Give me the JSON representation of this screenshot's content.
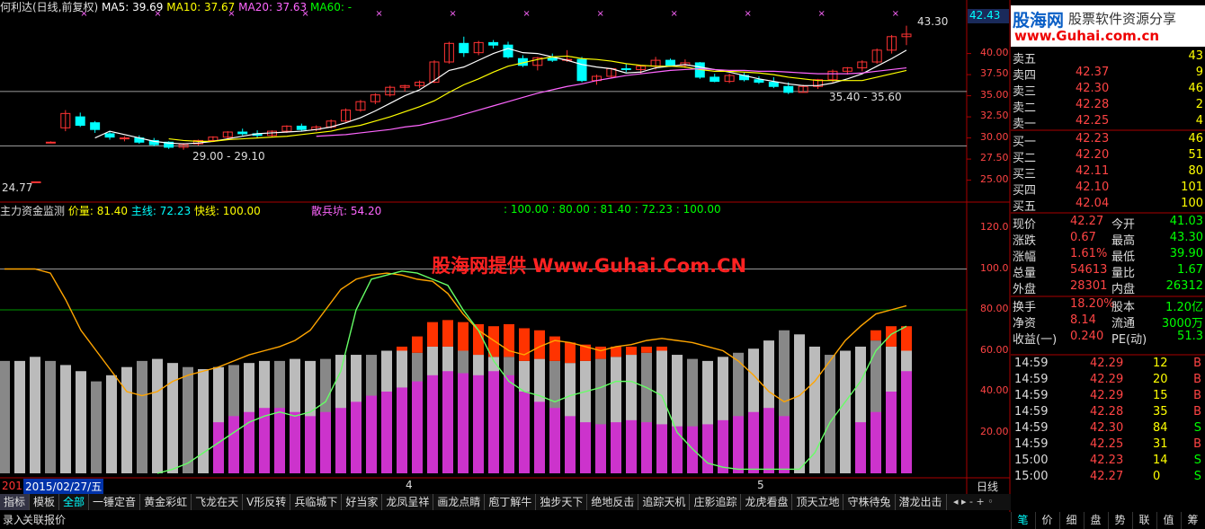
{
  "main_header": {
    "name": "何利达(日线,前复权)",
    "ma5": "MA5: 39.69",
    "ma10": "MA10: 37.67",
    "ma20": "MA20: 37.63",
    "ma60": "MA60: -"
  },
  "sub_header": {
    "name": "主力资金监测",
    "jialiang": "价量: 81.40",
    "zhuxian": "主线: 72.23",
    "kuaixian": "快线: 100.00",
    "sanbing": "散兵坑: 54.20",
    "values": ": 100.00 : 80.00 : 81.40 : 72.23 : 100.00"
  },
  "annotations": {
    "high_label": "43.30",
    "low_label": "24.77",
    "range1": "29.00 - 29.10",
    "range2": "35.40 - 35.60",
    "cur_price_tag": "42.43"
  },
  "price_axis": [
    "40.00",
    "37.50",
    "35.00",
    "32.50",
    "30.00",
    "27.50",
    "25.00"
  ],
  "ind_axis": [
    "120.0",
    "100.0",
    "80.00",
    "60.00",
    "40.00",
    "20.00"
  ],
  "time_axis": {
    "date_label": "2015/02/27/五",
    "left_num": "201",
    "m4": "4",
    "m5": "5",
    "period": "日线"
  },
  "watermark": "股海网提供 Www.Guhai.Com.CN",
  "logo": {
    "cn": "股海网",
    "slogan": "股票软件资源分享",
    "url": "www.Guhai.com.cn"
  },
  "order_book": [
    {
      "label": "卖五",
      "price": "",
      "vol": "43"
    },
    {
      "label": "卖四",
      "price": "42.37",
      "vol": "9"
    },
    {
      "label": "卖三",
      "price": "42.30",
      "vol": "46"
    },
    {
      "label": "卖二",
      "price": "42.28",
      "vol": "2"
    },
    {
      "label": "卖一",
      "price": "42.25",
      "vol": "4"
    },
    {
      "label": "买一",
      "price": "42.23",
      "vol": "46"
    },
    {
      "label": "买二",
      "price": "42.20",
      "vol": "51"
    },
    {
      "label": "买三",
      "price": "42.11",
      "vol": "80"
    },
    {
      "label": "买四",
      "price": "42.10",
      "vol": "101"
    },
    {
      "label": "买五",
      "price": "42.04",
      "vol": "100"
    }
  ],
  "stats": [
    {
      "l1": "现价",
      "v1": "42.27",
      "l2": "今开",
      "v2": "41.03"
    },
    {
      "l1": "涨跌",
      "v1": "0.67",
      "l2": "最高",
      "v2": "43.30"
    },
    {
      "l1": "涨幅",
      "v1": "1.61%",
      "l2": "最低",
      "v2": "39.90"
    },
    {
      "l1": "总量",
      "v1": "54613",
      "l2": "量比",
      "v2": "1.67"
    },
    {
      "l1": "外盘",
      "v1": "28301",
      "l2": "内盘",
      "v2": "26312"
    },
    {
      "l1": "换手",
      "v1": "18.20%",
      "l2": "股本",
      "v2": "1.20亿"
    },
    {
      "l1": "净资",
      "v1": "8.14",
      "l2": "流通",
      "v2": "3000万"
    },
    {
      "l1": "收益(一)",
      "v1": "0.240",
      "l2": "PE(动)",
      "v2": "51.3"
    }
  ],
  "ticks": [
    {
      "t": "14:59",
      "p": "42.29",
      "v": "12",
      "s": "B"
    },
    {
      "t": "14:59",
      "p": "42.29",
      "v": "20",
      "s": "B"
    },
    {
      "t": "14:59",
      "p": "42.29",
      "v": "15",
      "s": "B"
    },
    {
      "t": "14:59",
      "p": "42.28",
      "v": "35",
      "s": "B"
    },
    {
      "t": "14:59",
      "p": "42.30",
      "v": "84",
      "s": "S"
    },
    {
      "t": "14:59",
      "p": "42.25",
      "v": "31",
      "s": "B"
    },
    {
      "t": "15:00",
      "p": "42.23",
      "v": "14",
      "s": "S"
    },
    {
      "t": "15:00",
      "p": "42.27",
      "v": "0",
      "s": "S"
    }
  ],
  "tabs": [
    "指标",
    "模板",
    "全部",
    "一锤定音",
    "黄金彩虹",
    "飞龙在天",
    "V形反转",
    "兵临城下",
    "好当家",
    "龙凤呈祥",
    "画龙点睛",
    "庖丁解牛",
    "独步天下",
    "绝地反击",
    "追踪天机",
    "庄影追踪",
    "龙虎看盘",
    "顶天立地",
    "守株待兔",
    "潜龙出击"
  ],
  "bottom_tabs": [
    "录入",
    "关联报价"
  ],
  "bottom_right_tabs": [
    "笔",
    "价",
    "细",
    "盘",
    "势",
    "联",
    "值",
    "筹"
  ],
  "colors": {
    "up": "#ff3333",
    "down": "#00ffff",
    "ma5": "#ffffff",
    "ma10": "#ffff00",
    "ma20": "#ff66ff",
    "orange": "#ffa500",
    "green": "#66ff66"
  },
  "chart_data": [
    {
      "type": "candlestick",
      "title": "何利达(日线,前复权)",
      "ylim": [
        24,
        44
      ],
      "ohlc": [
        [
          24.8,
          24.8,
          24.8,
          24.8
        ],
        [
          29.5,
          29.6,
          29.4,
          29.5
        ],
        [
          31.2,
          33.3,
          30.8,
          32.9
        ],
        [
          32.5,
          33.0,
          31.3,
          31.5
        ],
        [
          31.8,
          32.0,
          30.6,
          31.0
        ],
        [
          30.5,
          30.8,
          29.8,
          30.1
        ],
        [
          29.9,
          30.2,
          29.6,
          30.0
        ],
        [
          30.0,
          30.3,
          29.3,
          29.5
        ],
        [
          29.7,
          30.0,
          29.0,
          29.2
        ],
        [
          29.5,
          29.6,
          28.7,
          28.9
        ],
        [
          28.9,
          29.4,
          28.6,
          29.2
        ],
        [
          29.3,
          29.8,
          29.1,
          29.7
        ],
        [
          29.7,
          30.2,
          29.5,
          30.1
        ],
        [
          30.1,
          30.8,
          29.9,
          30.7
        ],
        [
          30.7,
          31.1,
          30.3,
          30.5
        ],
        [
          30.5,
          30.9,
          30.0,
          30.3
        ],
        [
          30.3,
          30.9,
          30.1,
          30.8
        ],
        [
          30.8,
          31.5,
          30.6,
          31.4
        ],
        [
          31.4,
          31.7,
          30.8,
          31.0
        ],
        [
          31.0,
          31.5,
          30.8,
          31.3
        ],
        [
          31.3,
          32.2,
          31.1,
          32.0
        ],
        [
          32.0,
          33.5,
          31.9,
          33.3
        ],
        [
          33.3,
          34.5,
          33.1,
          34.3
        ],
        [
          34.3,
          35.3,
          34.0,
          35.1
        ],
        [
          35.1,
          36.2,
          34.9,
          36.0
        ],
        [
          36.0,
          36.3,
          35.5,
          36.2
        ],
        [
          36.2,
          36.8,
          35.9,
          36.6
        ],
        [
          36.6,
          39.2,
          36.5,
          39.0
        ],
        [
          39.0,
          41.4,
          38.8,
          41.2
        ],
        [
          41.2,
          42.0,
          39.6,
          40.1
        ],
        [
          40.1,
          41.5,
          39.8,
          41.3
        ],
        [
          41.3,
          41.6,
          40.6,
          41.0
        ],
        [
          41.0,
          41.4,
          39.4,
          39.6
        ],
        [
          39.4,
          39.8,
          38.4,
          38.6
        ],
        [
          38.6,
          39.6,
          38.0,
          39.5
        ],
        [
          39.5,
          40.0,
          39.0,
          39.2
        ],
        [
          39.2,
          40.4,
          39.0,
          39.3
        ],
        [
          39.3,
          39.6,
          36.6,
          36.8
        ],
        [
          36.8,
          37.5,
          36.3,
          37.3
        ],
        [
          37.3,
          38.3,
          37.1,
          38.2
        ],
        [
          38.2,
          38.8,
          37.8,
          38.1
        ],
        [
          38.1,
          38.6,
          37.6,
          38.5
        ],
        [
          38.5,
          39.6,
          38.1,
          39.2
        ],
        [
          39.2,
          39.4,
          38.5,
          38.6
        ],
        [
          38.6,
          39.3,
          38.3,
          38.9
        ],
        [
          38.9,
          39.0,
          37.0,
          37.2
        ],
        [
          37.2,
          37.6,
          36.6,
          36.7
        ],
        [
          36.7,
          37.6,
          36.5,
          37.4
        ],
        [
          37.4,
          37.7,
          36.7,
          36.9
        ],
        [
          36.9,
          37.3,
          36.4,
          36.6
        ],
        [
          36.6,
          37.2,
          35.9,
          36.1
        ],
        [
          36.1,
          36.6,
          35.2,
          35.4
        ],
        [
          35.4,
          36.3,
          35.4,
          36.1
        ],
        [
          36.1,
          37.0,
          35.8,
          36.9
        ],
        [
          36.9,
          38.1,
          36.6,
          37.9
        ],
        [
          37.9,
          38.4,
          37.5,
          38.3
        ],
        [
          38.3,
          39.2,
          37.9,
          39.0
        ],
        [
          39.0,
          40.6,
          38.8,
          40.4
        ],
        [
          40.4,
          42.2,
          40.0,
          42.0
        ],
        [
          42.0,
          43.3,
          41.0,
          42.3
        ]
      ],
      "ma5": [
        null,
        null,
        null,
        null,
        30.0,
        30.8,
        30.4,
        30.0,
        29.6,
        29.4,
        29.3,
        29.4,
        29.6,
        29.9,
        30.2,
        30.5,
        30.6,
        30.7,
        30.8,
        31.0,
        31.3,
        31.8,
        32.4,
        33.2,
        34.1,
        35.0,
        35.7,
        36.8,
        38.0,
        38.4,
        39.2,
        40.0,
        40.6,
        40.1,
        40.0,
        39.6,
        39.2,
        38.7,
        38.4,
        38.2,
        37.7,
        37.8,
        38.3,
        38.5,
        38.7,
        38.4,
        38.1,
        37.8,
        37.4,
        37.0,
        36.7,
        36.4,
        36.2,
        36.2,
        36.5,
        37.0,
        37.6,
        38.5,
        39.4,
        40.4
      ],
      "ma10": [
        null,
        null,
        null,
        null,
        null,
        null,
        null,
        null,
        null,
        29.9,
        29.7,
        29.6,
        29.6,
        29.8,
        29.9,
        30.0,
        30.1,
        30.2,
        30.4,
        30.6,
        30.8,
        31.2,
        31.5,
        32.0,
        32.5,
        33.1,
        33.7,
        34.4,
        35.4,
        36.3,
        37.0,
        37.8,
        38.5,
        38.9,
        39.3,
        39.6,
        39.7,
        39.4,
        39.3,
        39.1,
        38.8,
        38.6,
        38.5,
        38.5,
        38.4,
        38.1,
        37.9,
        37.9,
        37.8,
        37.7,
        37.5,
        37.2,
        37.0,
        36.8,
        36.8,
        36.8,
        36.8,
        37.2,
        37.6,
        38.0
      ],
      "ma20": [
        null,
        null,
        null,
        null,
        null,
        null,
        null,
        null,
        null,
        null,
        null,
        null,
        null,
        null,
        null,
        null,
        null,
        null,
        null,
        30.2,
        30.3,
        30.4,
        30.6,
        30.8,
        31.0,
        31.3,
        31.5,
        31.9,
        32.3,
        32.8,
        33.3,
        33.8,
        34.3,
        34.8,
        35.3,
        35.7,
        36.1,
        36.4,
        36.8,
        37.1,
        37.4,
        37.6,
        37.8,
        38.0,
        38.1,
        38.2,
        38.1,
        38.0,
        38.0,
        37.9,
        37.9,
        37.8,
        37.7,
        37.6,
        37.6,
        37.6,
        37.7,
        37.9,
        38.1,
        38.3
      ]
    },
    {
      "type": "bar",
      "title": "主力资金监测",
      "ylim": [
        0,
        130
      ],
      "base": [
        55,
        55,
        57,
        55,
        53,
        50,
        45,
        48,
        52,
        55,
        56,
        54,
        52,
        51,
        52,
        53,
        54,
        55,
        55,
        56,
        55,
        56,
        58,
        58,
        58,
        60,
        60,
        59,
        62,
        62,
        60,
        58,
        57,
        57,
        55,
        56,
        55,
        54,
        55,
        56,
        57,
        58,
        59,
        60,
        58,
        56,
        55,
        57,
        59,
        61,
        65,
        70,
        68,
        62,
        58,
        60,
        62,
        65,
        62,
        60
      ],
      "main": [
        0,
        0,
        0,
        0,
        0,
        0,
        0,
        0,
        0,
        0,
        0,
        0,
        0,
        0,
        5,
        8,
        10,
        12,
        12,
        10,
        8,
        10,
        12,
        15,
        18,
        20,
        22,
        25,
        28,
        30,
        29,
        28,
        30,
        28,
        20,
        15,
        12,
        8,
        5,
        4,
        5,
        6,
        5,
        4,
        3,
        3,
        4,
        6,
        8,
        10,
        12,
        8,
        0,
        0,
        0,
        0,
        5,
        10,
        20,
        30
      ],
      "top": [
        0,
        0,
        0,
        0,
        0,
        0,
        0,
        0,
        0,
        0,
        0,
        0,
        0,
        0,
        0,
        0,
        0,
        0,
        0,
        0,
        0,
        0,
        0,
        0,
        0,
        0,
        2,
        8,
        12,
        13,
        14,
        15,
        15,
        16,
        16,
        14,
        12,
        10,
        8,
        6,
        5,
        4,
        3,
        2,
        0,
        0,
        0,
        0,
        0,
        0,
        0,
        0,
        0,
        0,
        0,
        0,
        0,
        5,
        10,
        12
      ],
      "orange_line": [
        100,
        100,
        100,
        98,
        85,
        70,
        60,
        50,
        40,
        38,
        40,
        45,
        48,
        50,
        52,
        55,
        58,
        60,
        62,
        65,
        70,
        80,
        90,
        95,
        97,
        98,
        97,
        95,
        94,
        88,
        78,
        70,
        65,
        60,
        58,
        62,
        65,
        64,
        62,
        60,
        62,
        63,
        65,
        66,
        65,
        64,
        62,
        60,
        55,
        48,
        40,
        35,
        38,
        45,
        55,
        65,
        72,
        78,
        80,
        82
      ],
      "green_line": [
        null,
        null,
        null,
        null,
        null,
        null,
        null,
        null,
        null,
        null,
        0,
        2,
        5,
        10,
        15,
        20,
        25,
        28,
        30,
        28,
        30,
        35,
        50,
        80,
        95,
        97,
        99,
        98,
        95,
        92,
        80,
        70,
        55,
        45,
        40,
        38,
        35,
        38,
        40,
        42,
        45,
        45,
        42,
        38,
        20,
        12,
        5,
        3,
        2,
        2,
        2,
        2,
        2,
        10,
        25,
        35,
        45,
        60,
        68,
        72
      ]
    }
  ]
}
